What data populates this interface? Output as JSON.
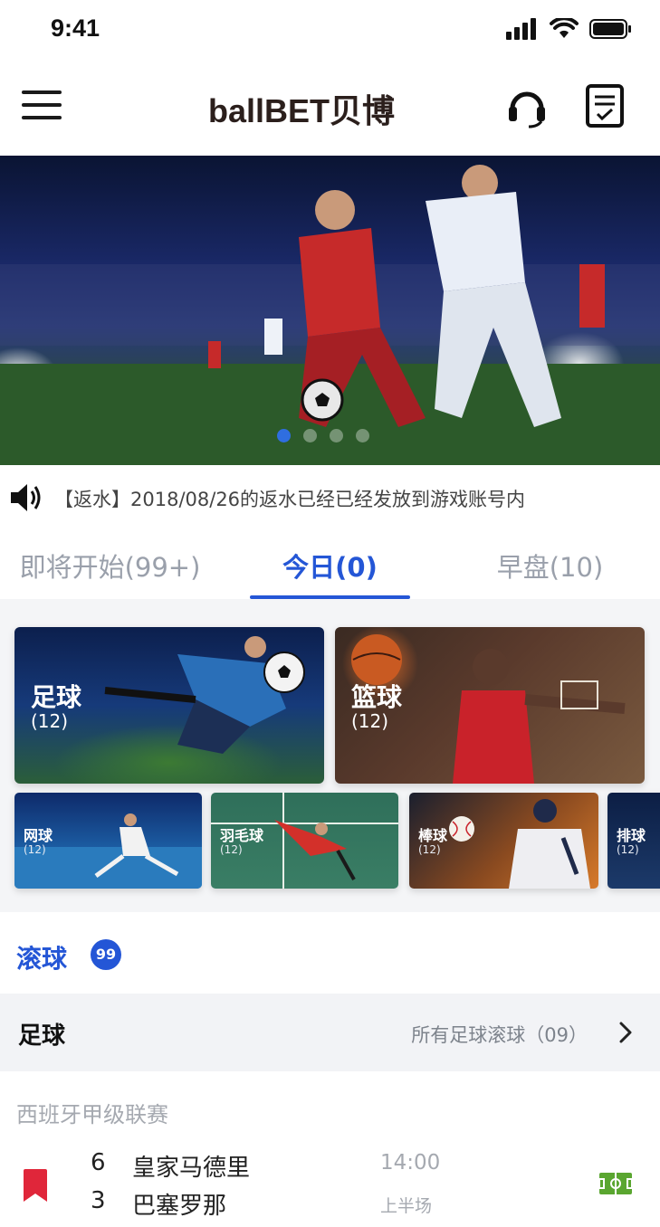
{
  "status_bar": {
    "time": "9:41"
  },
  "header": {
    "logo_text": "ballBET贝博",
    "icons": [
      "menu-icon",
      "headset-icon",
      "orders-icon"
    ]
  },
  "banner": {
    "slide_count": 4,
    "active_slide": 1
  },
  "notice": {
    "icon": "speaker-icon",
    "text": "【返水】2018/08/26的返水已经已经发放到游戏账号内"
  },
  "tabs": [
    {
      "label": "即将开始(99+)",
      "active": false
    },
    {
      "label": "今日(0)",
      "active": true
    },
    {
      "label": "早盘(10)",
      "active": false
    }
  ],
  "sports": {
    "featured": [
      {
        "name": "足球",
        "count": "(12)"
      },
      {
        "name": "篮球",
        "count": "(12)"
      }
    ],
    "others": [
      {
        "name": "网球",
        "count": "(12)"
      },
      {
        "name": "羽毛球",
        "count": "(12)"
      },
      {
        "name": "棒球",
        "count": "(12)"
      },
      {
        "name": "排球",
        "count": "(12)"
      }
    ]
  },
  "live": {
    "title": "滚球",
    "badge": "99"
  },
  "sport_section": {
    "title": "足球",
    "link": "所有足球滚球（09）"
  },
  "league": "西班牙甲级联赛",
  "match": {
    "home_score": "6",
    "home_team": "皇家马德里",
    "away_score": "3",
    "away_team": "巴塞罗那",
    "time": "14:00",
    "period": "上半场"
  },
  "colors": {
    "accent": "#2456d6",
    "bookmark": "#e0263a",
    "pitch": "#5aa630"
  }
}
